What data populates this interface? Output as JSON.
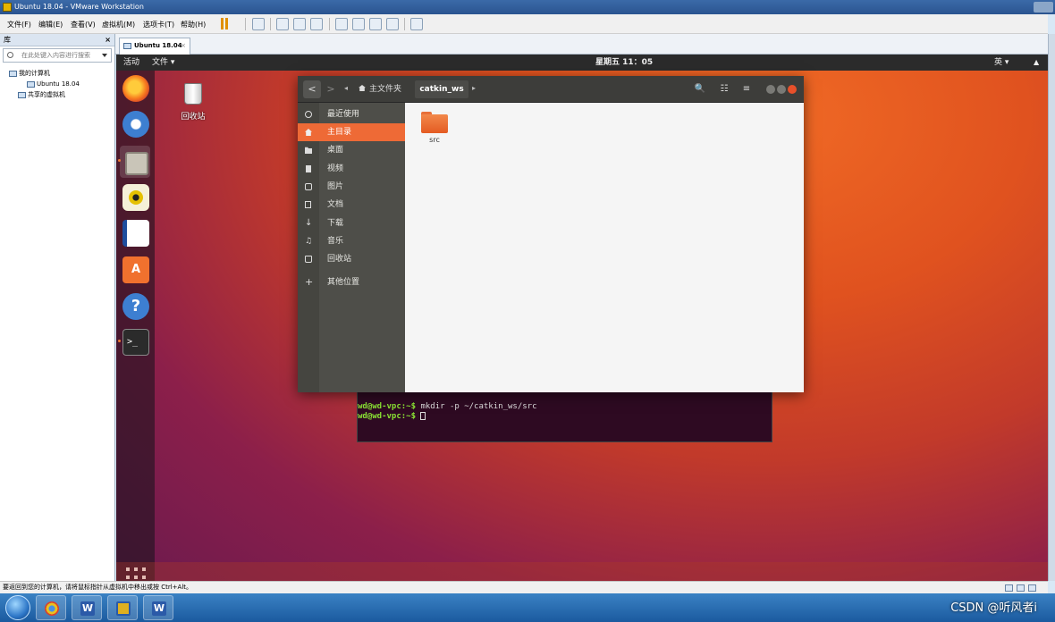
{
  "vmware": {
    "title": "Ubuntu 18.04 - VMware Workstation",
    "menu": [
      "文件(F)",
      "编辑(E)",
      "查看(V)",
      "虚拟机(M)",
      "选项卡(T)",
      "帮助(H)"
    ],
    "library": {
      "header": "库",
      "close": "×",
      "search_placeholder": "在此处键入内容进行搜索",
      "tree": [
        "我的计算机",
        "Ubuntu 18.04",
        "共享的虚拟机"
      ]
    },
    "tab": {
      "label": "Ubuntu 18.04",
      "close": "×"
    },
    "status_text": "要返回到您的计算机，请将鼠标指针从虚拟机中移出或按 Ctrl+Alt。"
  },
  "ubuntu": {
    "top_panel": {
      "activities": "活动",
      "app_menu": "文件 ▾",
      "clock": "星期五 11：05",
      "lang": "英 ▾",
      "menu": "▲"
    },
    "desktop_trash_label": "回收站",
    "files": {
      "nav_back": "<",
      "nav_forward": ">",
      "crumb_left": "◂",
      "home_crumb": "主文件夹",
      "current_crumb": "catkin_ws",
      "crumb_right": "▸",
      "search_btn": "🔍",
      "view_btn": "☷",
      "menu_btn": "≡",
      "sidebar": [
        {
          "icon": "clock-icon",
          "label": "最近使用"
        },
        {
          "icon": "home-icon",
          "label": "主目录",
          "selected": true
        },
        {
          "icon": "folder-icon",
          "label": "桌面"
        },
        {
          "icon": "video-icon",
          "label": "视频"
        },
        {
          "icon": "image-icon",
          "label": "图片"
        },
        {
          "icon": "document-icon",
          "label": "文档"
        },
        {
          "icon": "download-icon",
          "label": "下载"
        },
        {
          "icon": "music-icon",
          "label": "音乐"
        },
        {
          "icon": "trash-icon",
          "label": "回收站"
        },
        {
          "icon": "plus-icon",
          "label": "其他位置"
        }
      ],
      "items": [
        {
          "name": "src",
          "type": "folder"
        }
      ]
    },
    "terminal": {
      "lines": [
        {
          "prompt": "wd@wd-vpc:~$",
          "command": " mkdir -p ~/catkin_ws/src"
        },
        {
          "prompt": "wd@wd-vpc:~$",
          "command": " "
        }
      ]
    },
    "dock": [
      "firefox-icon",
      "thunderbird-icon",
      "files-icon",
      "rhythmbox-icon",
      "writer-icon",
      "software-center-icon",
      "help-icon",
      "terminal-icon",
      "show-apps-icon"
    ]
  },
  "taskbar": {
    "watermark": "CSDN @听风者i"
  }
}
